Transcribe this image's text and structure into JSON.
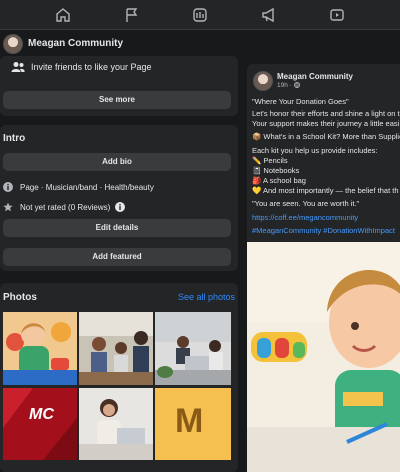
{
  "nav": {
    "icons": [
      "home-icon",
      "flag-icon",
      "marketplace-icon",
      "megaphone-icon",
      "video-icon"
    ]
  },
  "header": {
    "page_name": "Meagan Community"
  },
  "invite": {
    "label": "Invite friends to like your Page",
    "see_more": "See more"
  },
  "intro": {
    "title": "Intro",
    "add_bio": "Add bio",
    "category": "Page · Musician/band · Health/beauty",
    "rating": "Not yet rated (0 Reviews)",
    "edit_details": "Edit details",
    "add_featured": "Add featured"
  },
  "photos": {
    "title": "Photos",
    "see_all": "See all photos",
    "tile_mc": "MC",
    "tile_m": "M"
  },
  "post": {
    "author": "Meagan Community",
    "time": "19h · ",
    "lines": [
      "\"Where Your Donation Goes\"",
      "Let's honor their efforts and shine a light on t",
      "Your support makes their journey a little easi",
      "📦 What's in a School Kit? More than Supplie",
      "Each kit you help us provide includes:",
      "✏️ Pencils",
      "📓 Notebooks",
      "🎒 A school bag",
      "💛 And most importantly — the belief that th",
      "\"You are seen. You are worth it.\"",
      "https://coff.ee/megancommunity",
      "#MeaganCommunity #DonationWithImpact"
    ]
  },
  "colors": {
    "background": "#18191a",
    "card": "#242526",
    "button": "#3a3b3c",
    "link": "#2d88ff",
    "text": "#e4e6eb"
  }
}
